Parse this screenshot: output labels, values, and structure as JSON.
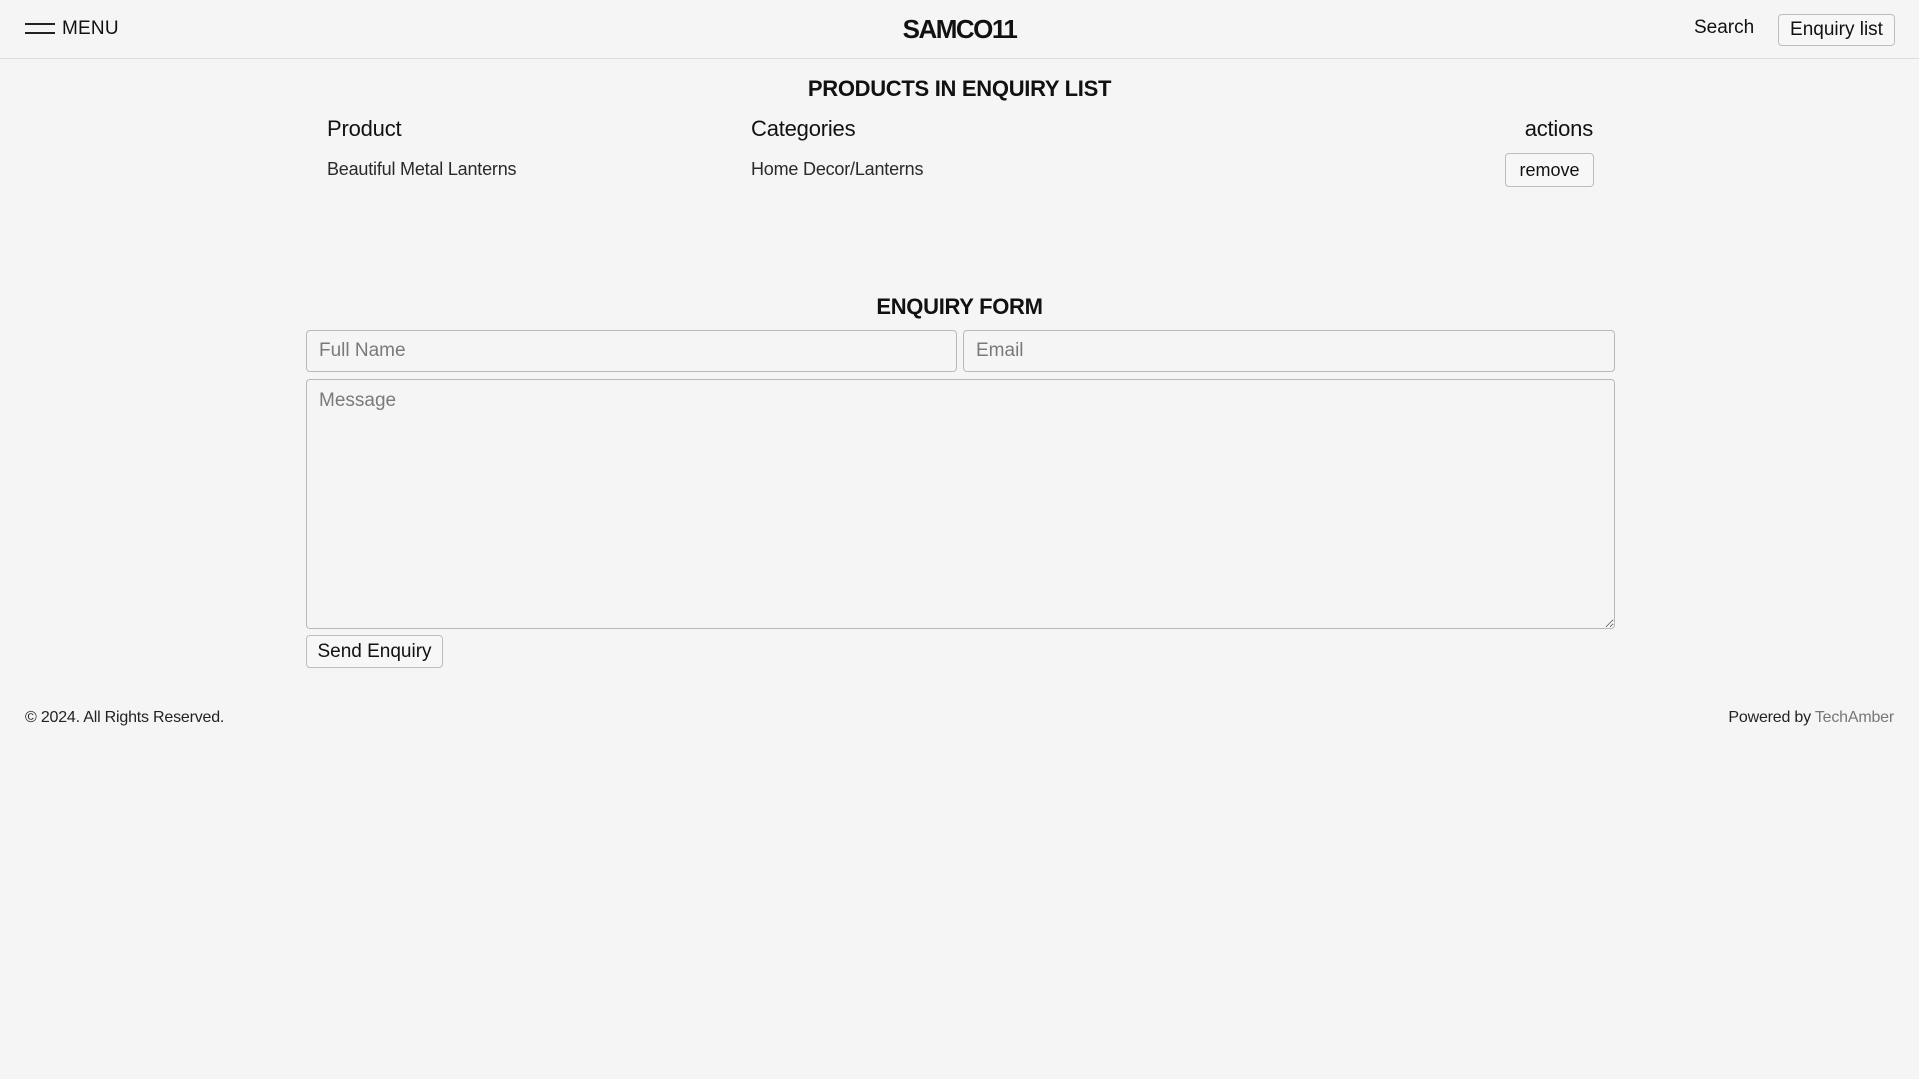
{
  "header": {
    "menu_label": "MENU",
    "logo_text": "SAMCO11",
    "search_label": "Search",
    "enquiry_list_label": "Enquiry list"
  },
  "enquiry_list": {
    "title": "PRODUCTS IN ENQUIRY LIST",
    "columns": [
      "Product",
      "Categories",
      "actions"
    ],
    "rows": [
      {
        "product": "Beautiful Metal Lanterns",
        "category": "Home Decor/Lanterns",
        "action_label": "remove"
      }
    ]
  },
  "enquiry_form": {
    "title": "ENQUIRY FORM",
    "full_name_placeholder": "Full Name",
    "email_placeholder": "Email",
    "message_placeholder": "Message",
    "submit_label": "Send Enquiry"
  },
  "footer": {
    "copyright": "© 2024. All Rights Reserved.",
    "powered_prefix": "Powered by ",
    "powered_link": "TechAmber"
  },
  "colors": {
    "background": "#f5f5f5",
    "text": "#111111",
    "border": "#bdbdbd",
    "muted_link": "#777777"
  },
  "icons": {
    "menu": "hamburger-icon"
  }
}
